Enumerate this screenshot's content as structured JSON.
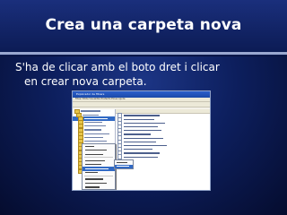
{
  "slide": {
    "title": "Crea una carpeta nova",
    "body_line1": "S'ha de clicar amb el boto dret i clicar",
    "body_line2": "en crear nova carpeta."
  },
  "screenshot": {
    "window_title": "Explorador de fitxers",
    "menu_items": "Fitxer  Edita  Visualitza  Preferits  Eines  Ajuda",
    "tree_rows": 17,
    "selected_tree_row": 2,
    "list_rows": 12,
    "context_menu_items": 10,
    "highlighted_context_item": 5
  },
  "colors": {
    "background": "#0d1f5e",
    "title_text": "#ffffff",
    "rule": "#9aa8d0",
    "selection": "#316ac5"
  }
}
